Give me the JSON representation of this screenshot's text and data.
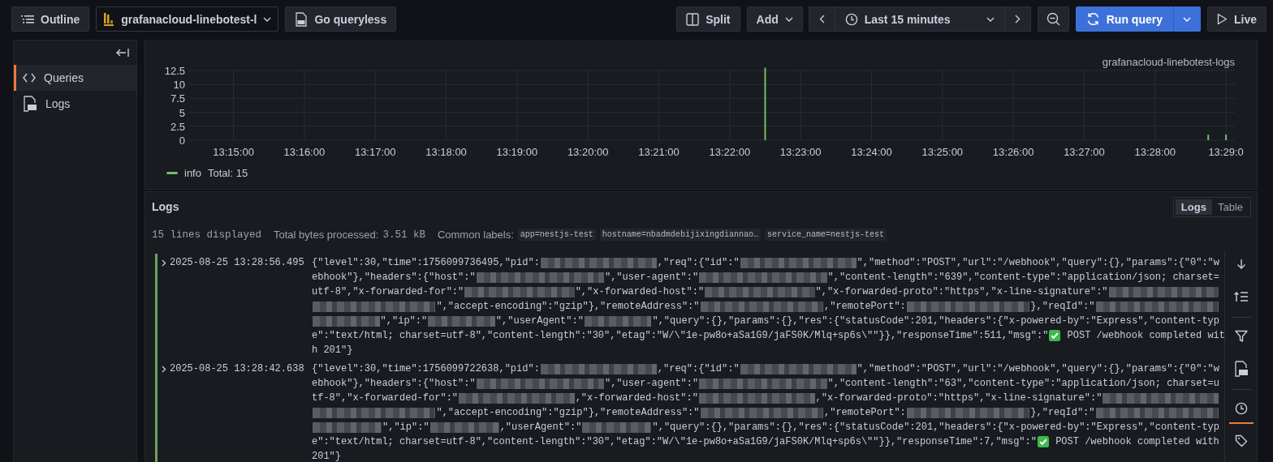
{
  "toolbar": {
    "outline": "Outline",
    "datasource": "grafanacloud-linebotest-l",
    "queryless": "Go queryless",
    "split": "Split",
    "add": "Add",
    "time_range": "Last 15 minutes",
    "run_query": "Run query",
    "live": "Live"
  },
  "sidebar": {
    "items": [
      {
        "kind": "code",
        "label": "Queries",
        "selected": true
      },
      {
        "kind": "log",
        "label": "Logs",
        "selected": false
      }
    ]
  },
  "logs_volume": {
    "series_label": "grafanacloud-linebotest-logs",
    "legend_total": "Total: 15",
    "chart_data": {
      "type": "bar",
      "grid": true,
      "categories": [
        null,
        null,
        "13:15:00",
        null,
        null,
        null,
        "13:16:00",
        null,
        null,
        null,
        "13:17:00",
        null,
        null,
        null,
        "13:18:00",
        null,
        null,
        null,
        "13:19:00",
        null,
        null,
        null,
        "13:20:00",
        null,
        null,
        null,
        "13:21:00",
        null,
        null,
        null,
        "13:22:00",
        null,
        null,
        null,
        "13:23:00",
        null,
        null,
        null,
        "13:24:00",
        null,
        null,
        null,
        "13:25:00",
        null,
        null,
        null,
        "13:26:00",
        null,
        null,
        null,
        "13:27:00",
        null,
        null,
        null,
        "13:28:00",
        null,
        null,
        null,
        "13:29:0"
      ],
      "series": [
        {
          "name": "info",
          "color": "#73bf69",
          "values": [
            null,
            null,
            null,
            null,
            null,
            null,
            null,
            null,
            null,
            null,
            null,
            null,
            null,
            null,
            null,
            null,
            null,
            null,
            null,
            null,
            null,
            null,
            null,
            null,
            null,
            null,
            null,
            null,
            null,
            null,
            null,
            null,
            13,
            null,
            null,
            null,
            null,
            null,
            null,
            null,
            null,
            null,
            null,
            null,
            null,
            null,
            null,
            null,
            null,
            null,
            null,
            null,
            null,
            null,
            null,
            null,
            null,
            1,
            1
          ]
        }
      ],
      "ylim": [
        0,
        13
      ],
      "yticks": [
        0,
        {
          "value": 2.5,
          "label": "2.5"
        },
        5,
        {
          "value": 7.5,
          "label": "7.5"
        },
        10,
        {
          "value": 12.5,
          "label": "12.5"
        }
      ]
    }
  },
  "logs": {
    "title": "Logs",
    "views": [
      {
        "label": "Logs",
        "selected": true
      },
      {
        "label": "Table",
        "selected": false
      }
    ],
    "stats": {
      "lines": "15 lines displayed",
      "bytes_label": "Total bytes processed:",
      "bytes": "3.51 kB",
      "labels_title": "Common labels:",
      "labels": [
        "app=nestjs-test",
        "hostname=nbadmdebijixingdiannao…",
        "service_name=nestjs-test"
      ]
    },
    "entries": [
      {
        "timestamp": "2025-08-25 13:28:56.495",
        "wrapped_lines": [
          [
            {
              "kind": "text",
              "text": "{\"level\":30,\"time\":1756099736495,\"pid\":"
            },
            {
              "kind": "redacted"
            },
            {
              "kind": "text",
              "text": ",\"req\":{\"id\":\""
            },
            {
              "kind": "redacted"
            },
            {
              "kind": "text",
              "text": "\",\"method\":\"POST\",\"url\":\"/webhook\",\"query\":{},\"params\":{\"0\":\"w"
            }
          ],
          [
            {
              "kind": "text",
              "text": "ebhook\"},\"headers\":{\"host\":\""
            },
            {
              "kind": "redacted"
            },
            {
              "kind": "text",
              "text": "\",\"user-agent\":\""
            },
            {
              "kind": "redacted"
            },
            {
              "kind": "text",
              "text": "\",\"content-length\":\"639\",\"content-type\":\"application/json; charset="
            }
          ],
          [
            {
              "kind": "text",
              "text": "utf-8\",\"x-forwarded-for\":\""
            },
            {
              "kind": "redacted"
            },
            {
              "kind": "text",
              "text": "\",\"x-forwarded-host\":\""
            },
            {
              "kind": "redacted"
            },
            {
              "kind": "text",
              "text": "\",\"x-forwarded-proto\":\"https\",\"x-line-signature\":\""
            },
            {
              "kind": "redacted"
            }
          ],
          [
            {
              "kind": "redacted"
            },
            {
              "kind": "text",
              "text": "\",\"accept-encoding\":\"gzip\"},\"remoteAddress\":\""
            },
            {
              "kind": "redacted"
            },
            {
              "kind": "text",
              "text": ",\"remotePort\":"
            },
            {
              "kind": "redacted"
            },
            {
              "kind": "text",
              "text": "},\"reqId\":\""
            },
            {
              "kind": "redacted"
            }
          ],
          [
            {
              "kind": "redacted"
            },
            {
              "kind": "text",
              "text": "\",\"ip\":\""
            },
            {
              "kind": "redacted"
            },
            {
              "kind": "text",
              "text": "\",\"userAgent\":\""
            },
            {
              "kind": "redacted"
            },
            {
              "kind": "text",
              "text": "\",\"query\":{},\"params\":{},\"res\":{\"statusCode\":201,\"headers\":{\"x-powered-by\":\"Express\",\"content-typ"
            }
          ],
          [
            {
              "kind": "text",
              "text": "e\":\"text/html; charset=utf-8\",\"content-length\":\"30\",\"etag\":\"W/\\\"1e-pw8o+aSa1G9/jaFS0K/Mlq+sp6s\\\"\"}},\"responseTime\":511,\"msg\":\""
            },
            {
              "kind": "check"
            },
            {
              "kind": "text",
              "text": " POST /webhook completed wit"
            }
          ],
          [
            {
              "kind": "text",
              "text": "h 201\"}"
            }
          ]
        ]
      },
      {
        "timestamp": "2025-08-25 13:28:42.638",
        "wrapped_lines": [
          [
            {
              "kind": "text",
              "text": "{\"level\":30,\"time\":1756099722638,\"pid\":"
            },
            {
              "kind": "redacted"
            },
            {
              "kind": "text",
              "text": ",\"req\":{\"id\":\""
            },
            {
              "kind": "redacted"
            },
            {
              "kind": "text",
              "text": "\",\"method\":\"POST\",\"url\":\"/webhook\",\"query\":{},\"params\":{\"0\":\"w"
            }
          ],
          [
            {
              "kind": "text",
              "text": "ebhook\"},\"headers\":{\"host\":\""
            },
            {
              "kind": "redacted"
            },
            {
              "kind": "text",
              "text": "\",\"user-agent\":\""
            },
            {
              "kind": "redacted"
            },
            {
              "kind": "text",
              "text": "\",\"content-length\":\"63\",\"content-type\":\"application/json; charset=u"
            }
          ],
          [
            {
              "kind": "text",
              "text": "tf-8\",\"x-forwarded-for\":\""
            },
            {
              "kind": "redacted"
            },
            {
              "kind": "text",
              "text": ",\"x-forwarded-host\":\""
            },
            {
              "kind": "redacted"
            },
            {
              "kind": "text",
              "text": ",\"x-forwarded-proto\":\"https\",\"x-line-signature\":\""
            },
            {
              "kind": "redacted"
            }
          ],
          [
            {
              "kind": "redacted"
            },
            {
              "kind": "text",
              "text": "\",\"accept-encoding\":\"gzip\"},\"remoteAddress\":\""
            },
            {
              "kind": "redacted"
            },
            {
              "kind": "text",
              "text": ",\"remotePort\":"
            },
            {
              "kind": "redacted"
            },
            {
              "kind": "text",
              "text": "},\"reqId\":\""
            },
            {
              "kind": "redacted"
            }
          ],
          [
            {
              "kind": "redacted"
            },
            {
              "kind": "text",
              "text": "\",\"ip\":\""
            },
            {
              "kind": "redacted"
            },
            {
              "kind": "text",
              "text": ",\"userAgent\":\""
            },
            {
              "kind": "redacted"
            },
            {
              "kind": "text",
              "text": "\",\"query\":{},\"params\":{},\"res\":{\"statusCode\":201,\"headers\":{\"x-powered-by\":\"Express\",\"content-typ"
            }
          ],
          [
            {
              "kind": "text",
              "text": "e\":\"text/html; charset=utf-8\",\"content-length\":\"30\",\"etag\":\"W/\\\"1e-pw8o+aSa1G9/jaFS0K/Mlq+sp6s\\\"\"}},\"responseTime\":7,\"msg\":\""
            },
            {
              "kind": "check"
            },
            {
              "kind": "text",
              "text": " POST /webhook completed with"
            }
          ],
          [
            {
              "kind": "text",
              "text": "201\"}"
            }
          ]
        ]
      }
    ],
    "side_tools": [
      [
        {
          "kind": "scroll-down",
          "selected": false
        },
        {
          "kind": "sort",
          "selected": false
        }
      ],
      [
        {
          "kind": "filter",
          "selected": false
        },
        {
          "kind": "log",
          "selected": false
        }
      ],
      [
        {
          "kind": "clock",
          "selected": true
        },
        {
          "kind": "tag",
          "selected": false
        }
      ]
    ]
  }
}
